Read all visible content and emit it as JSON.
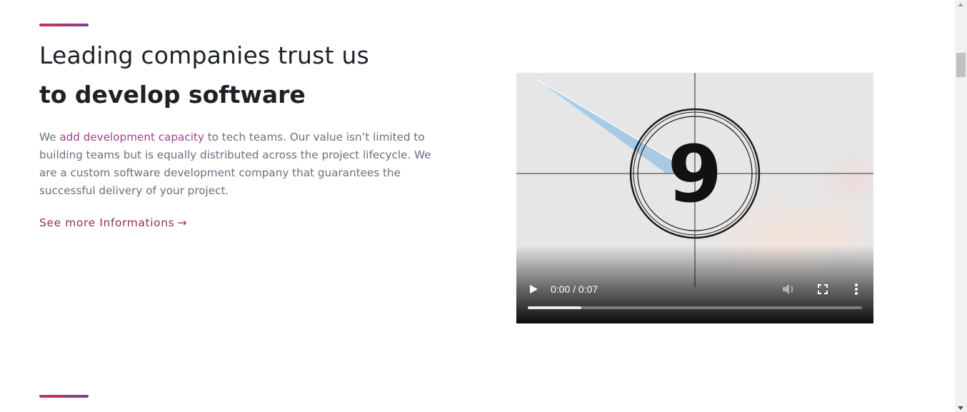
{
  "colors": {
    "accent_gradient_start": "#d6304a",
    "accent_gradient_end": "#7a3f9a",
    "link": "#a53f8e",
    "more_link": "#8e2f5d",
    "heading": "#1d2128",
    "body": "#6b6f7f"
  },
  "section": {
    "heading_line1": "Leading companies trust us",
    "heading_line2": "to develop software",
    "body_prefix": "We ",
    "body_link": "add development capacity",
    "body_rest": " to tech teams. Our value isn’t limited to building teams but is equally distributed across the project lifecycle. We are a custom software development company that guarantees the successful delivery of your project.",
    "more_link_label": "See more Informations",
    "more_link_arrow": "→"
  },
  "video": {
    "frame_number": "9",
    "time": "0:00 / 0:07",
    "progress": 0.16,
    "icons": {
      "play": "play-icon",
      "volume": "volume-icon",
      "fullscreen": "fullscreen-icon",
      "menu": "more-vertical-icon"
    }
  }
}
